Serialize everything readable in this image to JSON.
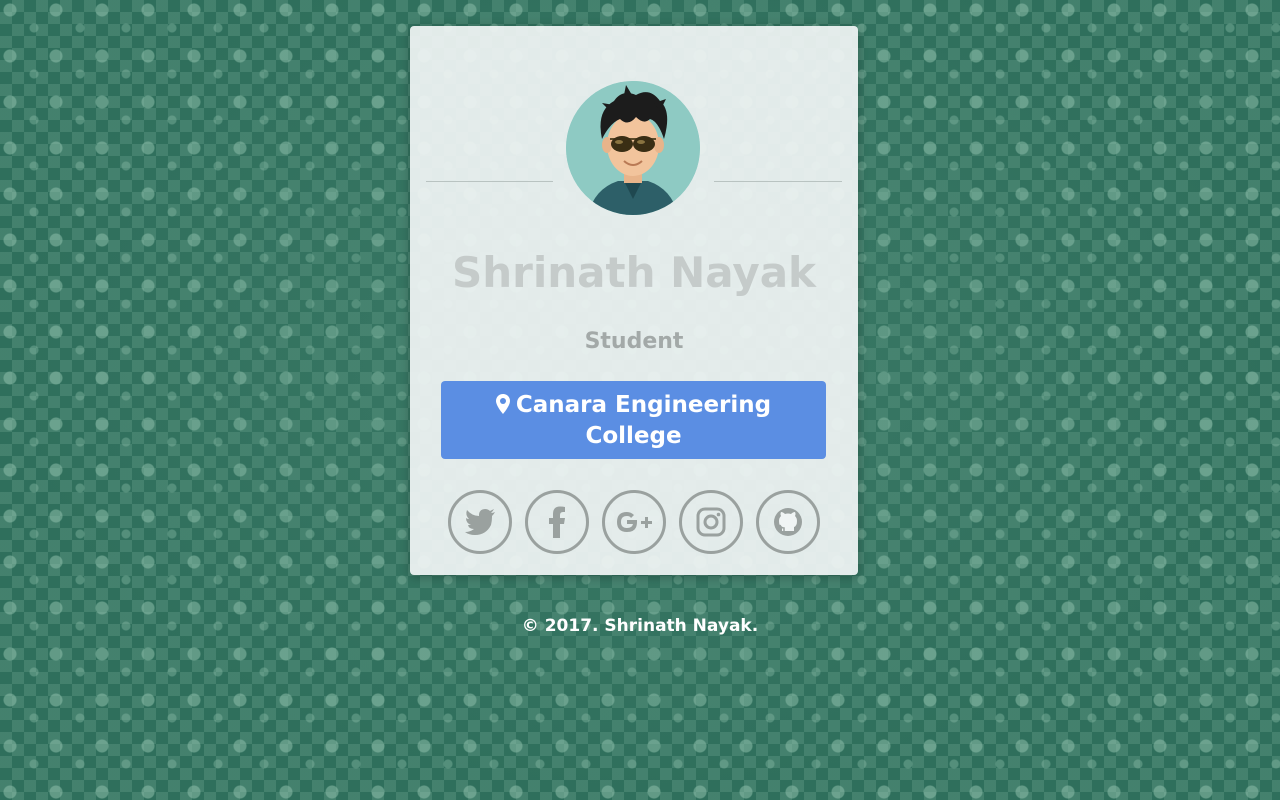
{
  "profile": {
    "name": "Shrinath Nayak",
    "role": "Student",
    "location": "Canara Engineering College",
    "avatar_icon": "cartoon-avatar-sunglasses"
  },
  "social": [
    {
      "name": "twitter-icon",
      "label": "Twitter"
    },
    {
      "name": "facebook-icon",
      "label": "Facebook"
    },
    {
      "name": "google-plus-icon",
      "label": "Google+"
    },
    {
      "name": "instagram-icon",
      "label": "Instagram"
    },
    {
      "name": "github-icon",
      "label": "GitHub"
    }
  ],
  "footer": {
    "text": "© 2017. Shrinath Nayak."
  },
  "colors": {
    "background": "#2f6f5c",
    "card": "#f0f4f4",
    "location_button": "#5b8ee3",
    "icon_gray": "#9aa19f"
  }
}
